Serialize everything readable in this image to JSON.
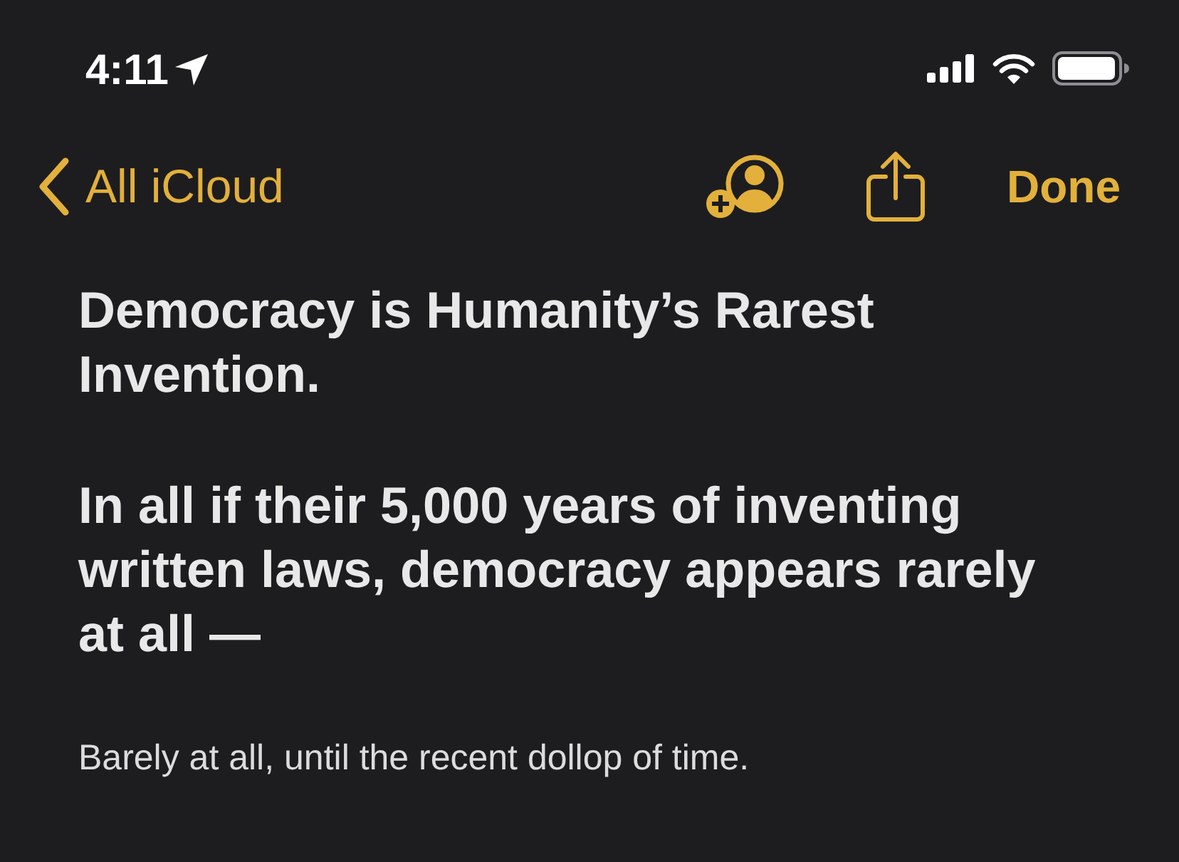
{
  "status_bar": {
    "time": "4:11"
  },
  "nav_bar": {
    "back_label": "All iCloud",
    "done_label": "Done"
  },
  "note": {
    "blocks": [
      {
        "kind": "heading",
        "text": "Democracy is Humanity’s Rarest Invention."
      },
      {
        "kind": "heading",
        "text": "In all if their 5,000 years of inventing written laws, democracy appears rarely at all —"
      },
      {
        "kind": "body",
        "text": "Barely at all, until the recent dollop of time."
      }
    ]
  }
}
